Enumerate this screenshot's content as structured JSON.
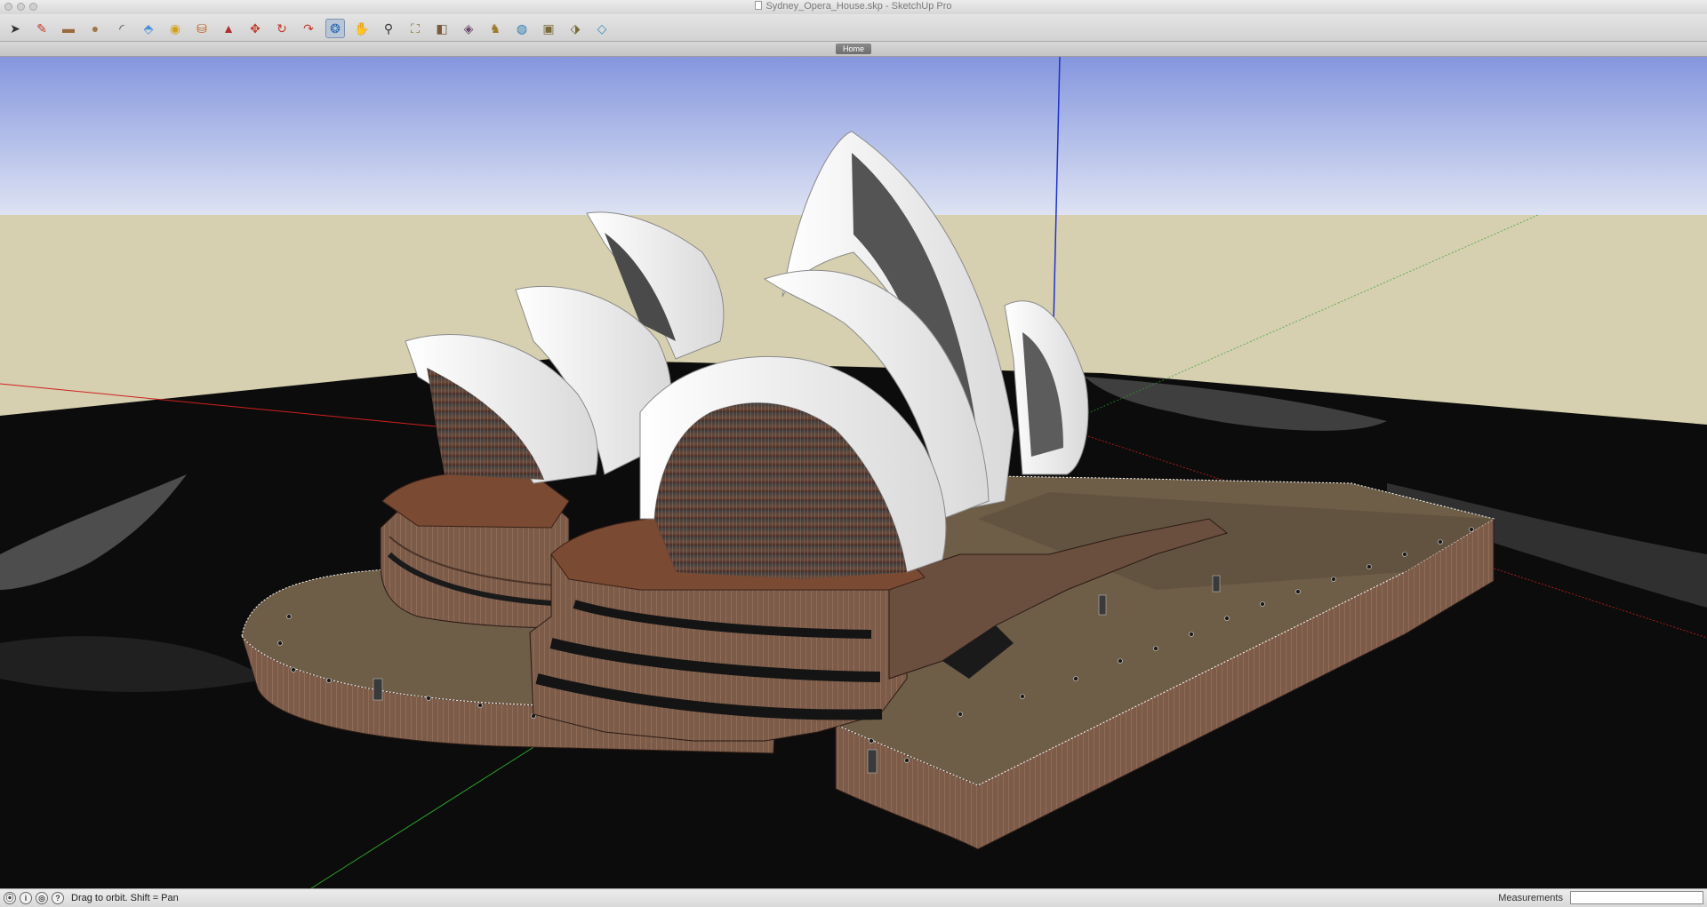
{
  "window": {
    "title": "Sydney_Opera_House.skp - SketchUp Pro"
  },
  "toolbar": {
    "tools": [
      {
        "name": "select-tool",
        "icon": "arrow-cursor-icon",
        "glyph": "➤",
        "color": "#333333"
      },
      {
        "name": "line-tool",
        "icon": "pencil-icon",
        "glyph": "✎",
        "color": "#c0392b"
      },
      {
        "name": "rectangle-tool",
        "icon": "rectangle-icon",
        "glyph": "▬",
        "color": "#9a6a3a"
      },
      {
        "name": "circle-tool",
        "icon": "circle-icon",
        "glyph": "●",
        "color": "#a0784a"
      },
      {
        "name": "arc-tool",
        "icon": "arc-icon",
        "glyph": "◜",
        "color": "#333333"
      },
      {
        "name": "eraser-tool",
        "icon": "eraser-icon",
        "glyph": "⬘",
        "color": "#4a90d9"
      },
      {
        "name": "tape-measure-tool",
        "icon": "tape-measure-icon",
        "glyph": "◉",
        "color": "#d4a017"
      },
      {
        "name": "paint-bucket-tool",
        "icon": "paint-bucket-icon",
        "glyph": "⛁",
        "color": "#c06020"
      },
      {
        "name": "push-pull-tool",
        "icon": "push-pull-icon",
        "glyph": "▲",
        "color": "#b03030"
      },
      {
        "name": "move-tool",
        "icon": "move-icon",
        "glyph": "✥",
        "color": "#c0392b"
      },
      {
        "name": "rotate-tool",
        "icon": "rotate-icon",
        "glyph": "↻",
        "color": "#c0392b"
      },
      {
        "name": "follow-me-tool",
        "icon": "follow-me-icon",
        "glyph": "↷",
        "color": "#c0392b"
      },
      {
        "name": "orbit-tool",
        "icon": "orbit-icon",
        "glyph": "❂",
        "color": "#2a6ab0",
        "active": true
      },
      {
        "name": "pan-tool",
        "icon": "hand-icon",
        "glyph": "✋",
        "color": "#555555"
      },
      {
        "name": "zoom-tool",
        "icon": "magnifier-icon",
        "glyph": "⚲",
        "color": "#333333"
      },
      {
        "name": "zoom-extents-tool",
        "icon": "zoom-extents-icon",
        "glyph": "⛶",
        "color": "#8a6d2a"
      },
      {
        "name": "previous-view-tool",
        "icon": "previous-view-icon",
        "glyph": "◧",
        "color": "#7a5a3a"
      },
      {
        "name": "position-camera-tool",
        "icon": "camera-icon",
        "glyph": "◈",
        "color": "#6a4a6a"
      },
      {
        "name": "walk-tool",
        "icon": "footprints-icon",
        "glyph": "♞",
        "color": "#9a7a2a"
      },
      {
        "name": "geo-location-tool",
        "icon": "globe-icon",
        "glyph": "◍",
        "color": "#2a7ab0"
      },
      {
        "name": "warehouse-tool",
        "icon": "3d-warehouse-icon",
        "glyph": "▣",
        "color": "#7a6a3a"
      },
      {
        "name": "share-model-tool",
        "icon": "share-model-icon",
        "glyph": "⬗",
        "color": "#7a6a3a"
      },
      {
        "name": "extension-tool",
        "icon": "extension-icon",
        "glyph": "◇",
        "color": "#3a8ac0"
      }
    ]
  },
  "scenes": {
    "tabs": [
      {
        "label": "Home"
      }
    ]
  },
  "statusbar": {
    "icons": [
      {
        "name": "geo-location-status-icon",
        "glyph": "⦿"
      },
      {
        "name": "credits-status-icon",
        "glyph": "i"
      },
      {
        "name": "user-status-icon",
        "glyph": "◎"
      },
      {
        "name": "help-status-icon",
        "glyph": "?"
      }
    ],
    "hint": "Drag to orbit.  Shift = Pan",
    "measurements_label": "Measurements",
    "measurements_value": ""
  },
  "colors": {
    "sky_top": "#8a9de0",
    "sky_bottom": "#dfe6f4",
    "ground": "#d6d0b0",
    "water": "#0c0c0c",
    "roof_shell": "#f4f4f4",
    "podium": "#6e5e48",
    "wall": "#7a5a48",
    "red_axis": "#d02020",
    "green_axis": "#2ca02c",
    "blue_axis": "#2030d0"
  }
}
